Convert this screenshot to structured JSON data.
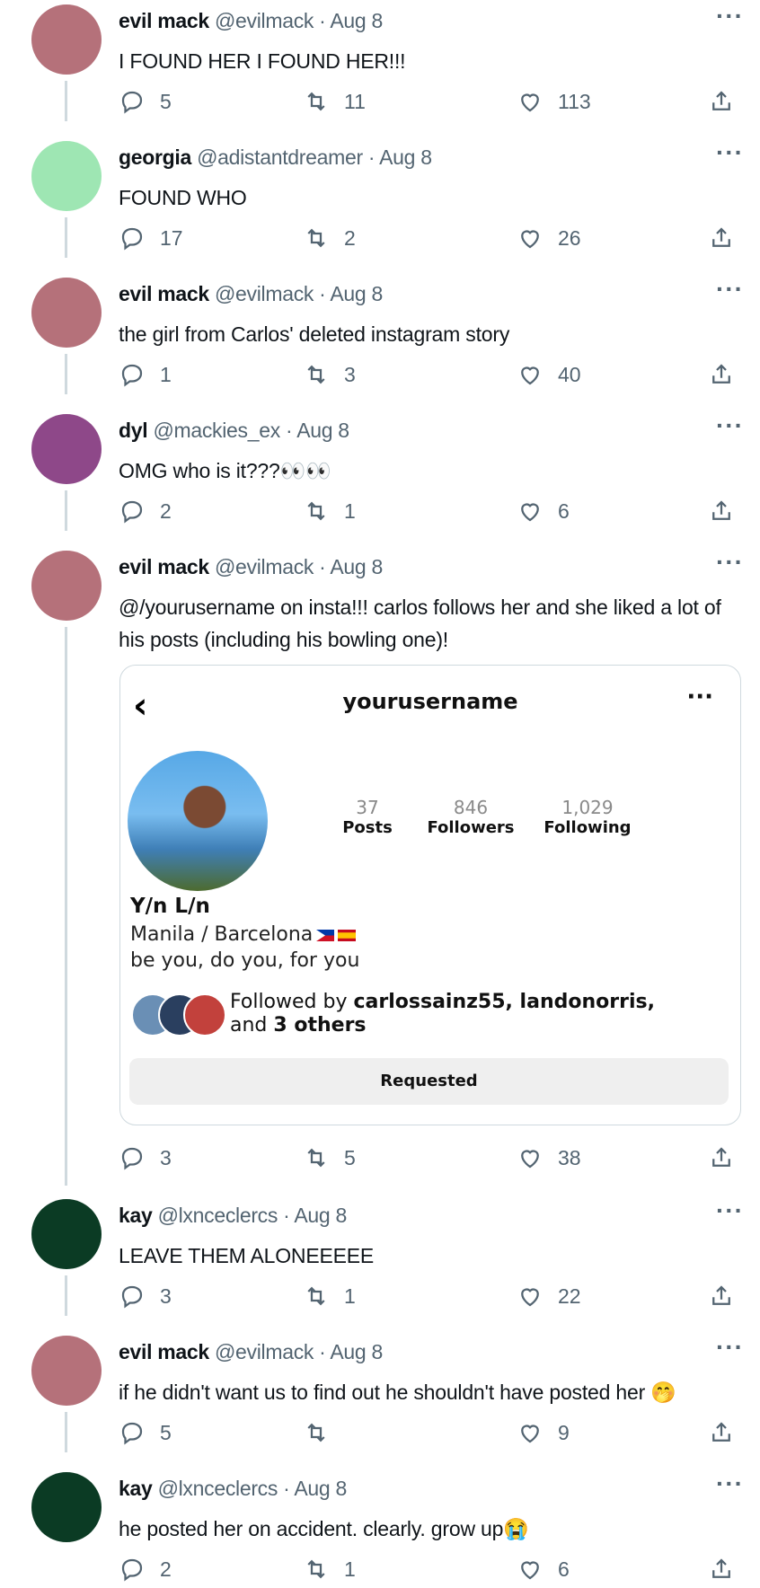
{
  "tweets": [
    {
      "name": "evil mack",
      "meta": "@evilmack · Aug 8",
      "text": "I FOUND HER I FOUND HER!!!",
      "replies": "5",
      "retweets": "11",
      "likes": "113",
      "avatar_color": "#b5717a"
    },
    {
      "name": "georgia",
      "meta": "@adistantdreamer · Aug 8",
      "text": "FOUND WHO",
      "replies": "17",
      "retweets": "2",
      "likes": "26",
      "avatar_color": "#9ee6b3"
    },
    {
      "name": "evil mack",
      "meta": "@evilmack · Aug 8",
      "text": "the girl from Carlos' deleted instagram story",
      "replies": "1",
      "retweets": "3",
      "likes": "40",
      "avatar_color": "#b5717a"
    },
    {
      "name": "dyl",
      "meta": "@mackies_ex · Aug 8",
      "text": "OMG who is it???👀👀",
      "replies": "2",
      "retweets": "1",
      "likes": "6",
      "avatar_color": "#8e4889"
    },
    {
      "name": "evil mack",
      "meta": "@evilmack · Aug 8",
      "text": "@/yourusername on insta!!! carlos follows her and she liked a lot of his posts (including his bowling one)!",
      "replies": "3",
      "retweets": "5",
      "likes": "38",
      "avatar_color": "#b5717a"
    },
    {
      "name": "kay",
      "meta": "@lxnceclercs · Aug 8",
      "text": "LEAVE THEM ALONEEEEE",
      "replies": "3",
      "retweets": "1",
      "likes": "22",
      "avatar_color": "#0b3b24"
    },
    {
      "name": "evil mack",
      "meta": "@evilmack · Aug 8",
      "text": "if he didn't want us to find out he shouldn't have posted her 🤭",
      "replies": "5",
      "retweets": "",
      "likes": "9",
      "avatar_color": "#b5717a"
    },
    {
      "name": "kay",
      "meta": "@lxnceclercs · Aug 8",
      "text": "he posted her on accident. clearly. grow up😭",
      "replies": "2",
      "retweets": "1",
      "likes": "6",
      "avatar_color": "#0b3b24"
    }
  ],
  "more_glyph": "···",
  "instagram": {
    "back_glyph": "‹",
    "username": "yourusername",
    "more_glyph": "···",
    "posts": "37",
    "posts_label": "Posts",
    "followers": "846",
    "followers_label": "Followers",
    "following": "1,029",
    "following_label": "Following",
    "display_name": "Y/n L/n",
    "location": "Manila / Barcelona",
    "bio": "be you, do you, for you",
    "followed_by_prefix": "Followed by ",
    "followed_by_names": "carlossainz55, landonorris,",
    "followed_by_and": "and ",
    "followed_by_others": "3 others",
    "button_label": "Requested"
  },
  "icons": {
    "reply": "reply-icon",
    "retweet": "retweet-icon",
    "like": "heart-icon",
    "share": "share-icon"
  },
  "colors": {
    "secondary_text": "#536471",
    "thread_line": "#cfd9de"
  }
}
